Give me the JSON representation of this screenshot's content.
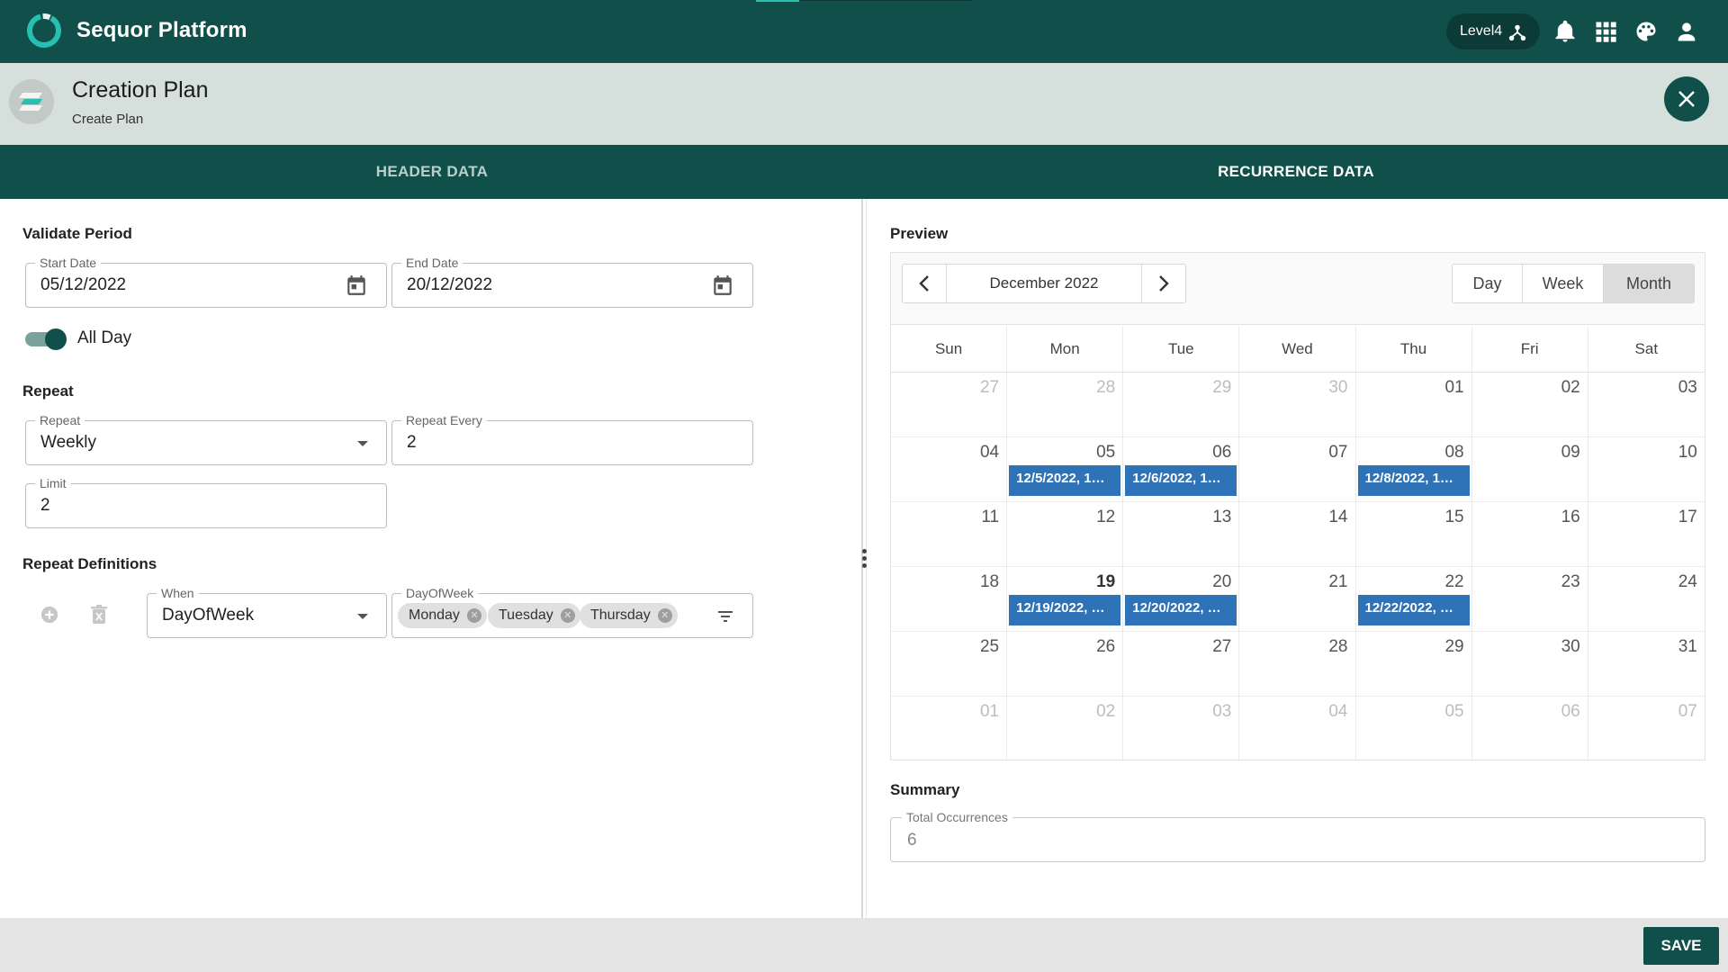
{
  "app": {
    "title": "Sequor Platform",
    "level": "Level4"
  },
  "page": {
    "title": "Creation Plan",
    "subtitle": "Create Plan"
  },
  "tabs": [
    {
      "label": "HEADER DATA"
    },
    {
      "label": "RECURRENCE DATA"
    }
  ],
  "colors": {
    "primary": "#11504a",
    "event": "#2e72b8",
    "accent": "#27c0b0"
  },
  "left": {
    "validate_period": {
      "label": "Validate Period",
      "start_date": {
        "label": "Start Date",
        "value": "05/12/2022",
        "icon": "calendar-icon"
      },
      "end_date": {
        "label": "End Date",
        "value": "20/12/2022",
        "icon": "calendar-icon"
      }
    },
    "all_day": {
      "label": "All Day",
      "checked": true
    },
    "repeat": {
      "label": "Repeat",
      "repeat": {
        "label": "Repeat",
        "value": "Weekly"
      },
      "repeat_every": {
        "label": "Repeat Every",
        "value": "2"
      },
      "limit": {
        "label": "Limit",
        "value": "2"
      }
    },
    "repeat_definitions": {
      "label": "Repeat Definitions",
      "when": {
        "label": "When",
        "value": "DayOfWeek"
      },
      "day_of_week": {
        "label": "DayOfWeek",
        "chips": [
          "Monday",
          "Tuesday",
          "Thursday"
        ]
      }
    }
  },
  "preview": {
    "label": "Preview",
    "month_title": "December 2022",
    "views": [
      "Day",
      "Week",
      "Month"
    ],
    "active_view": "Month",
    "weekdays": [
      "Sun",
      "Mon",
      "Tue",
      "Wed",
      "Thu",
      "Fri",
      "Sat"
    ],
    "weeks": [
      [
        {
          "n": "27",
          "o": true
        },
        {
          "n": "28",
          "o": true
        },
        {
          "n": "29",
          "o": true
        },
        {
          "n": "30",
          "o": true
        },
        {
          "n": "01"
        },
        {
          "n": "02"
        },
        {
          "n": "03"
        }
      ],
      [
        {
          "n": "04"
        },
        {
          "n": "05",
          "event": "12/5/2022, 1…"
        },
        {
          "n": "06",
          "event": "12/6/2022, 1…"
        },
        {
          "n": "07"
        },
        {
          "n": "08",
          "event": "12/8/2022, 1…"
        },
        {
          "n": "09"
        },
        {
          "n": "10"
        }
      ],
      [
        {
          "n": "11"
        },
        {
          "n": "12"
        },
        {
          "n": "13"
        },
        {
          "n": "14"
        },
        {
          "n": "15"
        },
        {
          "n": "16"
        },
        {
          "n": "17"
        }
      ],
      [
        {
          "n": "18"
        },
        {
          "n": "19",
          "today": true,
          "event": "12/19/2022, …"
        },
        {
          "n": "20",
          "event": "12/20/2022, …"
        },
        {
          "n": "21"
        },
        {
          "n": "22",
          "event": "12/22/2022, …"
        },
        {
          "n": "23"
        },
        {
          "n": "24"
        }
      ],
      [
        {
          "n": "25"
        },
        {
          "n": "26"
        },
        {
          "n": "27"
        },
        {
          "n": "28"
        },
        {
          "n": "29"
        },
        {
          "n": "30"
        },
        {
          "n": "31"
        }
      ],
      [
        {
          "n": "01",
          "o": true
        },
        {
          "n": "02",
          "o": true
        },
        {
          "n": "03",
          "o": true
        },
        {
          "n": "04",
          "o": true
        },
        {
          "n": "05",
          "o": true
        },
        {
          "n": "06",
          "o": true
        },
        {
          "n": "07",
          "o": true
        }
      ]
    ]
  },
  "summary": {
    "label": "Summary",
    "total_occurrences": {
      "label": "Total Occurrences",
      "value": "6"
    }
  },
  "footer": {
    "save_label": "SAVE"
  }
}
